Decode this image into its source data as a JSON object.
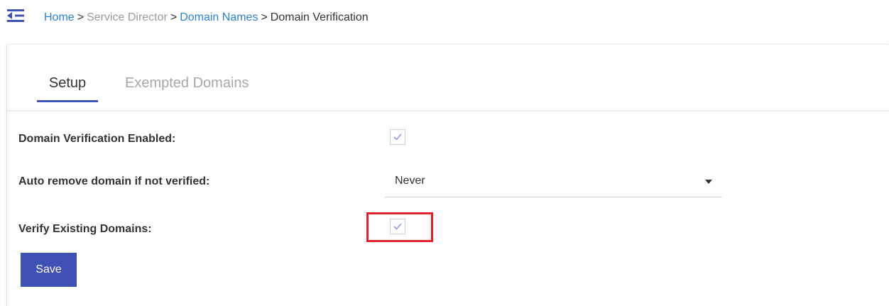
{
  "breadcrumb": {
    "home": "Home",
    "sep": ">",
    "service_director": "Service Director",
    "domain_names": "Domain Names",
    "current": "Domain Verification"
  },
  "tabs": [
    {
      "label": "Setup",
      "active": true
    },
    {
      "label": "Exempted Domains",
      "active": false
    }
  ],
  "form": {
    "verification_enabled": {
      "label": "Domain Verification Enabled:",
      "checked": true
    },
    "auto_remove": {
      "label": "Auto remove domain if not verified:",
      "value": "Never"
    },
    "verify_existing": {
      "label": "Verify Existing Domains:",
      "checked": true
    }
  },
  "save_label": "Save",
  "icons": {
    "menu_toggle": "menu-collapse-icon",
    "checkmark": "checkmark-icon",
    "caret": "chevron-down-icon"
  },
  "colors": {
    "accent": "#3f51b5",
    "link": "#2f80d0",
    "highlight": "#e0202a",
    "check": "#8e9be3"
  }
}
